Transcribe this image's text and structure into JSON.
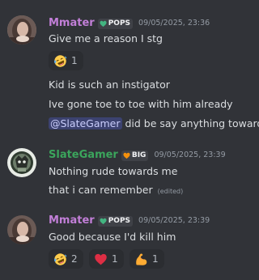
{
  "messages": [
    {
      "author": "Mmater",
      "author_color": "#c27fd8",
      "tag": "POPS",
      "tag_icon": "green-heart-icon",
      "timestamp": "09/05/2025, 23:36",
      "lines": [
        "Give me a reason I stg",
        "Kid is such an instigator",
        "Ive gone toe to toe with him already"
      ],
      "mention_line": {
        "mention": "@SlateGamer",
        "rest": " did be say anything towards"
      },
      "reactions": [
        {
          "emoji": "rolling-on-floor-laughing-emoji",
          "count": "1"
        }
      ]
    },
    {
      "author": "SlateGamer",
      "author_color": "#3ba55c",
      "tag": "BIG",
      "tag_icon": "orange-heart-icon",
      "timestamp": "09/05/2025, 23:39",
      "lines": [
        "Nothing rude towards me",
        "that i can remember"
      ],
      "edited_label": "(edited)"
    },
    {
      "author": "Mmater",
      "author_color": "#c27fd8",
      "tag": "POPS",
      "tag_icon": "green-heart-icon",
      "timestamp": "09/05/2025, 23:39",
      "lines": [
        "Good because I'd kill him"
      ],
      "reactions": [
        {
          "emoji": "rolling-on-floor-laughing-emoji",
          "count": "2"
        },
        {
          "emoji": "red-heart-emoji",
          "count": "1"
        },
        {
          "emoji": "flexed-biceps-emoji",
          "count": "1"
        }
      ]
    }
  ],
  "colors": {
    "background": "#313338",
    "text": "#dbdee1",
    "muted": "#949ba4",
    "mention_bg": "#3c4270"
  }
}
